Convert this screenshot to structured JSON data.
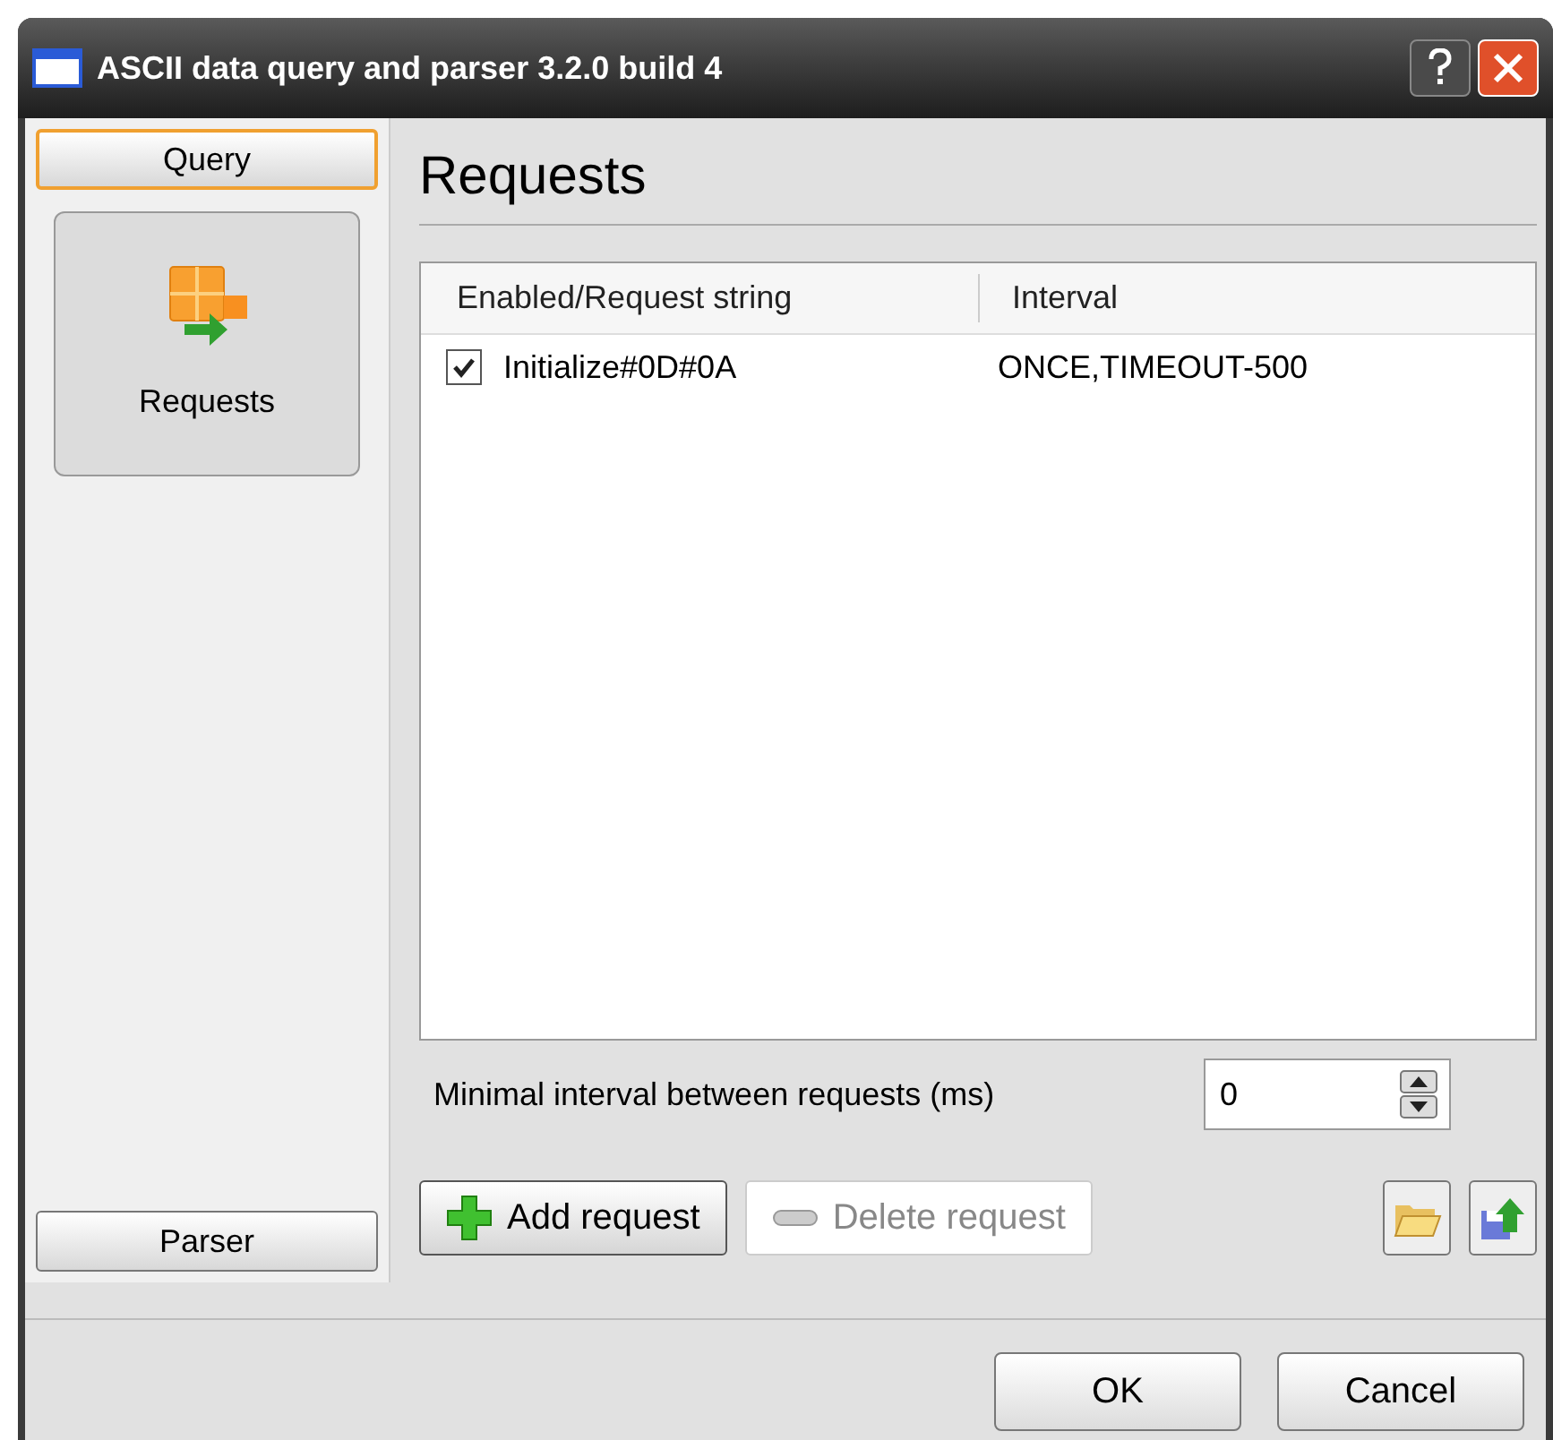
{
  "window": {
    "title": "ASCII data query and parser 3.2.0 build 4"
  },
  "sidebar": {
    "groups": [
      {
        "label": "Query",
        "selected": true
      },
      {
        "label": "Parser",
        "selected": false
      }
    ],
    "items": [
      {
        "label": "Requests",
        "selected": true
      }
    ]
  },
  "panel": {
    "heading": "Requests"
  },
  "table": {
    "columns": [
      "Enabled/Request string",
      "Interval"
    ],
    "rows": [
      {
        "checked": true,
        "request": "Initialize#0D#0A",
        "interval": "ONCE,TIMEOUT-500"
      }
    ]
  },
  "min_interval": {
    "label": "Minimal interval between requests (ms)",
    "value": "0"
  },
  "actions": [
    {
      "label": "Add request",
      "kind": "add",
      "disabled": false
    },
    {
      "label": "Delete request",
      "kind": "delete",
      "disabled": true
    }
  ],
  "footer_buttons": [
    "OK",
    "Cancel"
  ]
}
